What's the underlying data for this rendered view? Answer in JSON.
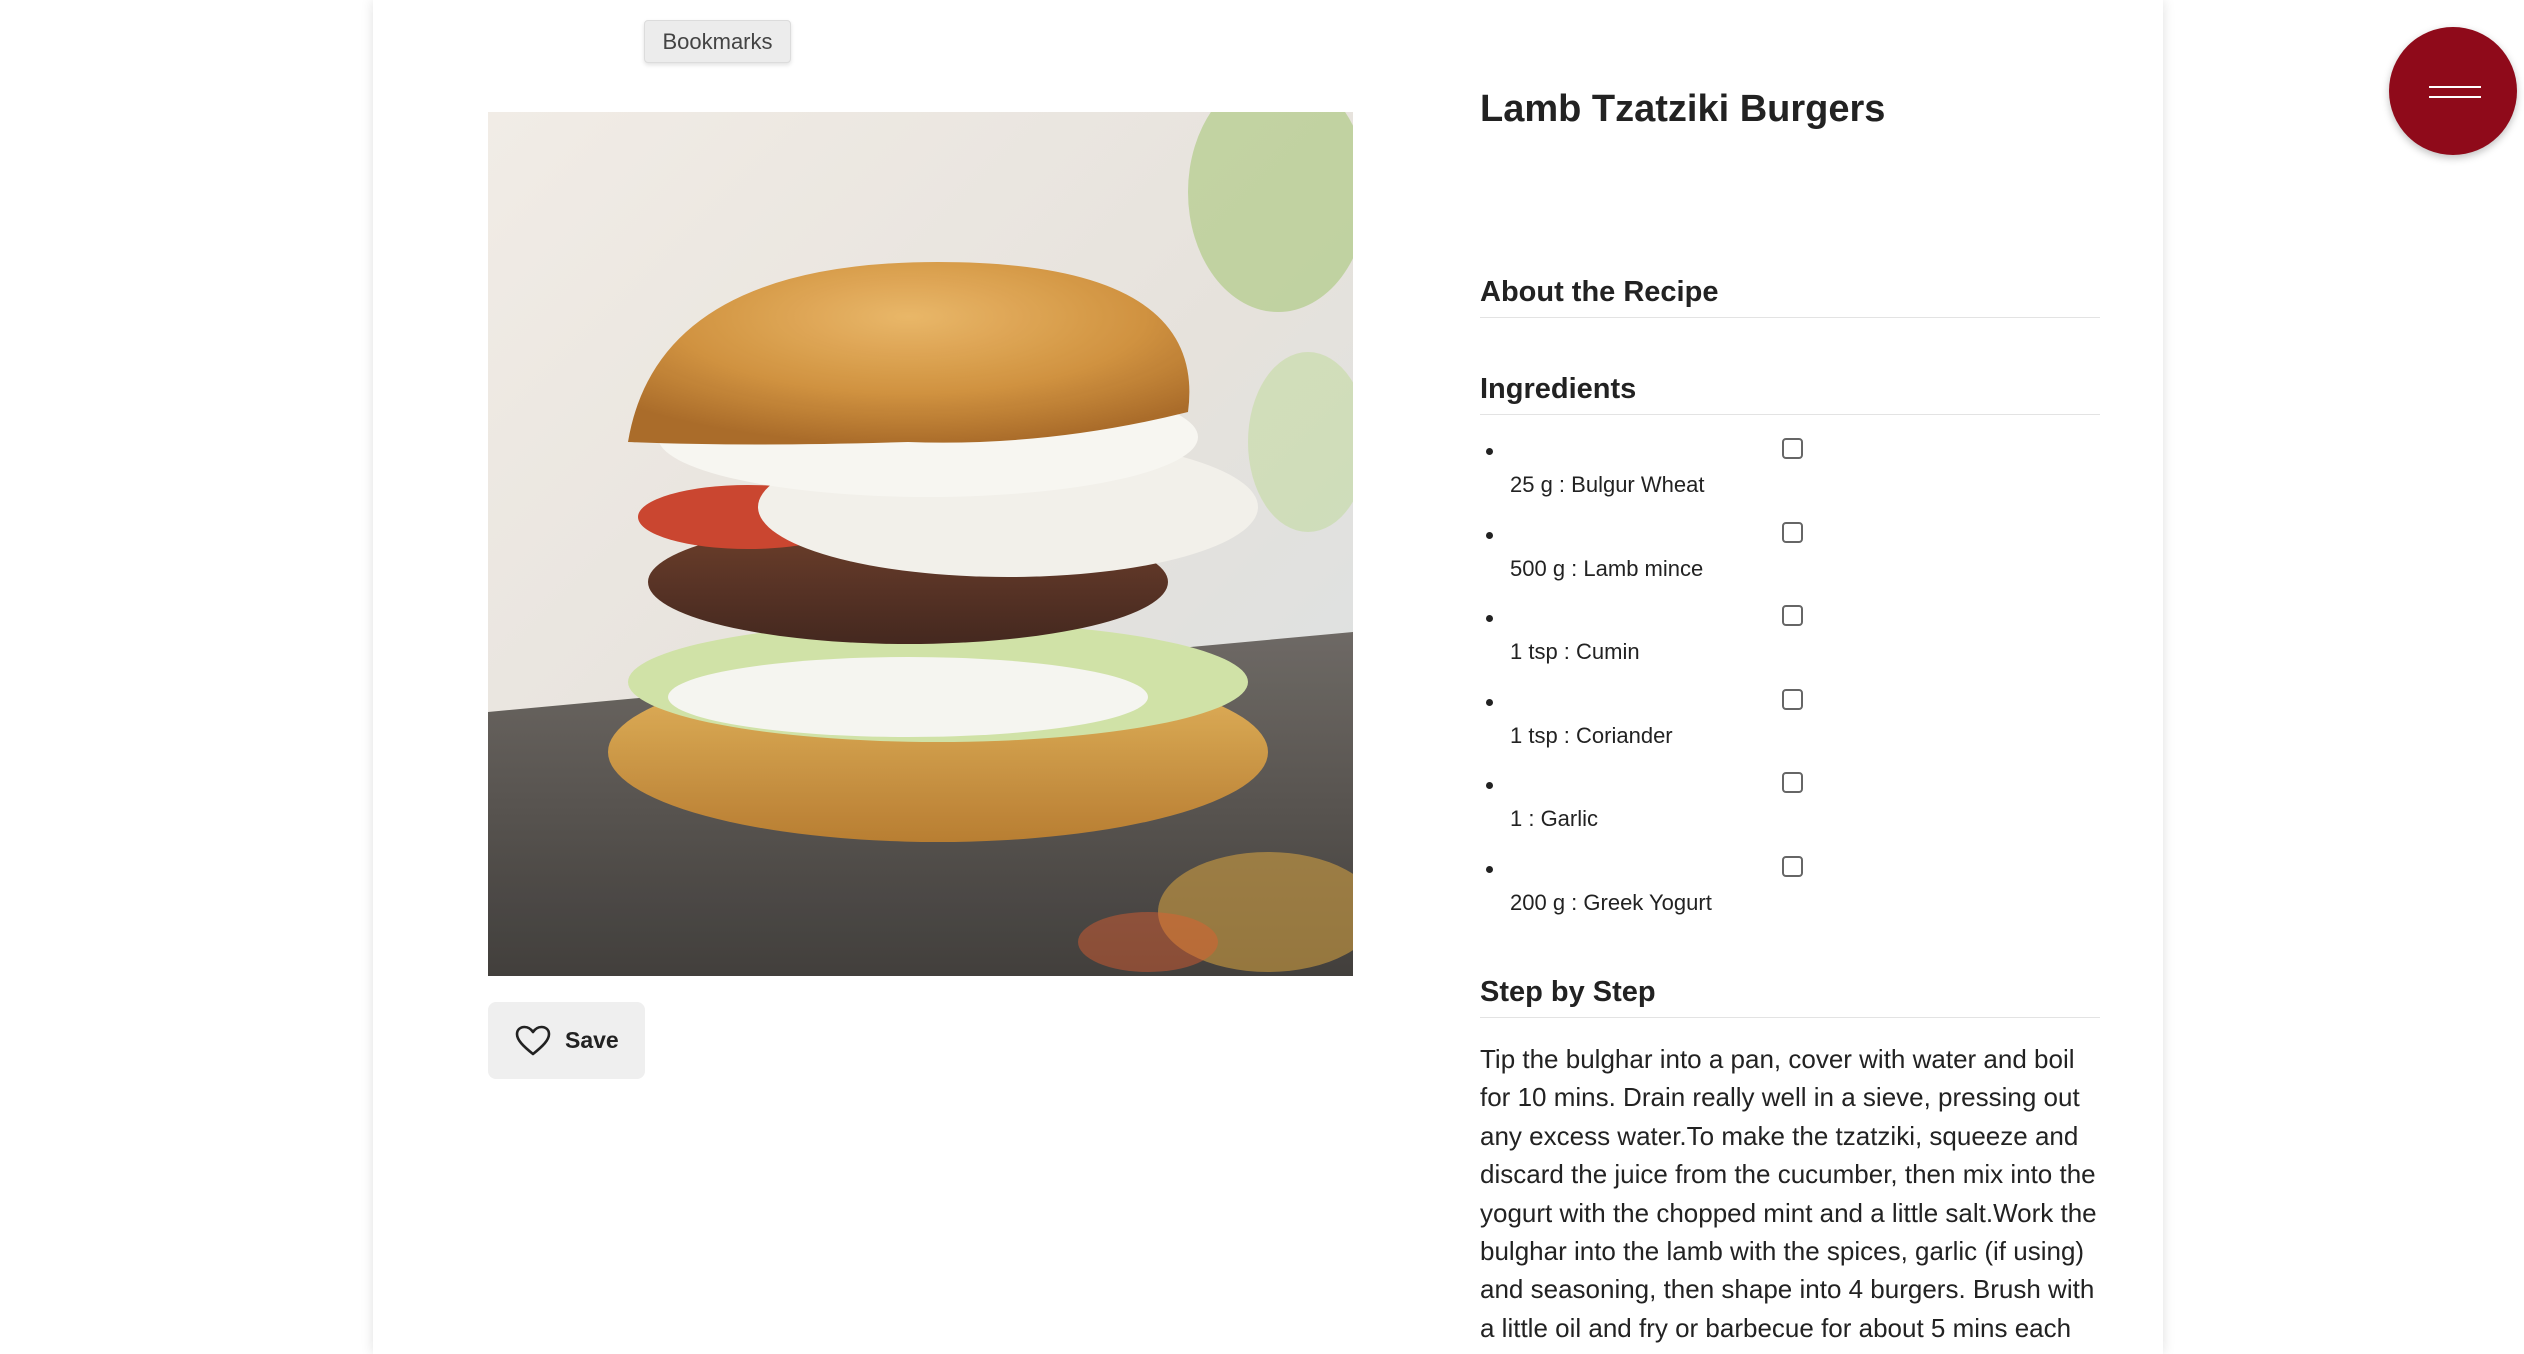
{
  "toolbar": {
    "bookmarks_label": "Bookmarks",
    "menu_icon": "hamburger-icon",
    "menu_color": "#8f0a1a"
  },
  "recipe": {
    "title": "Lamb Tzatziki Burgers",
    "image_subject": "lamb burger with tzatziki in a brioche bun",
    "save_label": "Save",
    "save_icon": "heart-outline-icon"
  },
  "sections": {
    "about": "About the Recipe",
    "ingredients": "Ingredients",
    "steps": "Step by Step"
  },
  "ingredients": [
    {
      "text": "25 g : Bulgur Wheat",
      "checked": false
    },
    {
      "text": "500 g : Lamb mince",
      "checked": false
    },
    {
      "text": "1 tsp : Cumin",
      "checked": false
    },
    {
      "text": "1 tsp : Coriander",
      "checked": false
    },
    {
      "text": "1 : Garlic",
      "checked": false
    },
    {
      "text": "200 g : Greek Yogurt",
      "checked": false
    }
  ],
  "steps_text": "Tip the bulghar into a pan, cover with water and boil for 10 mins. Drain really well in a sieve, pressing out any excess water.To make the tzatziki, squeeze and discard the juice from the cucumber, then mix into the yogurt with the chopped mint and a little salt.Work the bulghar into the lamb with the spices, garlic (if using) and seasoning, then shape into 4 burgers. Brush with a little oil and fry or barbecue for about 5 mins each"
}
